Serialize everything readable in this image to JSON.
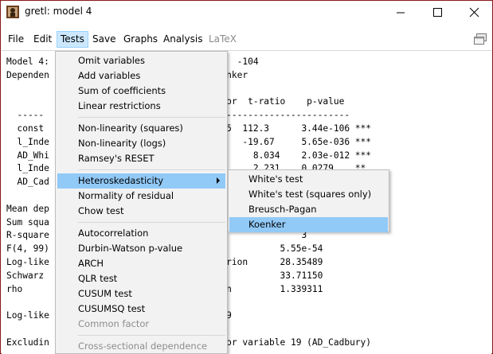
{
  "window": {
    "title": "gretl: model 4"
  },
  "menubar": {
    "items": [
      "File",
      "Edit",
      "Tests",
      "Save",
      "Graphs",
      "Analysis",
      "LaTeX"
    ],
    "active": "Tests",
    "disabled": [
      "LaTeX"
    ]
  },
  "output_lines": [
    "Model 4:                                   -104",
    "Dependen                                 nker",
    "",
    "                                 std. error  t-ratio    p-value",
    "  -----                          -------------------------------",
    "  const                          0.0402835  112.3      3.44e-106 ***",
    "  l_Inde                         0.236768   -19.67     5.65e-036 ***",
    "  AD_Whi                         0.114235     8.034    2.03e-012 ***",
    "  l_Inde                         0.265129     2.231    0.0279    **",
    "  AD_Cad                                               .927",
    "",
    "Mean dep                                               8",
    "Sum squa                                               6",
    "R-square                                               3",
    "F(4, 99)                        value(F)           5.55e-54",
    "Log-like                        ike criterion      28.35489",
    "Schwarz                         nan-Quinn          33.71150",
    "rho                             bin-Watson         1.339311",
    "",
    "Log-like                        = -553.809",
    "",
    "Excludin                        highest for variable 19 (AD_Cadbury)"
  ],
  "tests_menu": {
    "groups": [
      [
        "Omit variables",
        "Add variables",
        "Sum of coefficients",
        "Linear restrictions"
      ],
      [
        "Non-linearity (squares)",
        "Non-linearity (logs)",
        "Ramsey's RESET"
      ],
      [
        "Heteroskedasticity",
        "Normality of residual",
        "Chow test"
      ],
      [
        "Autocorrelation",
        "Durbin-Watson p-value",
        "ARCH",
        "QLR test",
        "CUSUM test",
        "CUSUMSQ test",
        "Common factor"
      ],
      [
        "Cross-sectional dependence"
      ]
    ],
    "highlighted": "Heteroskedasticity",
    "disabled": [
      "Common factor",
      "Cross-sectional dependence"
    ],
    "has_submenu": [
      "Heteroskedasticity"
    ]
  },
  "hetero_submenu": {
    "items": [
      "White's test",
      "White's test (squares only)",
      "Breusch-Pagan",
      "Koenker"
    ],
    "highlighted": "Koenker"
  },
  "colors": {
    "menu_highlight": "#91c9f7",
    "menubar_active": "#cce8ff",
    "window_border": "#8b1a1a"
  }
}
